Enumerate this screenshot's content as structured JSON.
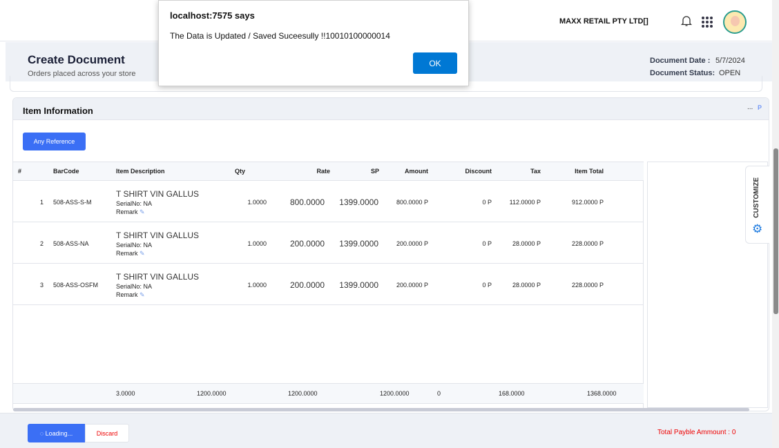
{
  "header": {
    "company": "MAXX RETAIL PTY LTD[]"
  },
  "page": {
    "title": "Create Document",
    "subtitle": "Orders placed across your store",
    "date_label": "Document Date :",
    "date_value": "5/7/2024",
    "status_label": "Document Status:",
    "status_value": "OPEN"
  },
  "items": {
    "title": "Item Information",
    "more": "...",
    "p_link": "P",
    "any_reference": "Any Reference",
    "columns": [
      "#",
      "BarCode",
      "Item Description",
      "Qty",
      "Rate",
      "SP",
      "Amount",
      "Discount",
      "Tax",
      "Item Total"
    ],
    "rows": [
      {
        "no": "1",
        "barcode": "508-ASS-S-M",
        "desc": "T SHIRT VIN GALLUS",
        "serial": "SerialNo: NA",
        "remark": "Remark",
        "qty": "1.0000",
        "rate": "800.0000",
        "sp": "1399.0000",
        "amount": "800.0000 P",
        "discount": "0 P",
        "tax": "112.0000 P",
        "total": "912.0000 P"
      },
      {
        "no": "2",
        "barcode": "508-ASS-NA",
        "desc": "T SHIRT VIN GALLUS",
        "serial": "SerialNo: NA",
        "remark": "Remark",
        "qty": "1.0000",
        "rate": "200.0000",
        "sp": "1399.0000",
        "amount": "200.0000 P",
        "discount": "0 P",
        "tax": "28.0000 P",
        "total": "228.0000 P"
      },
      {
        "no": "3",
        "barcode": "508-ASS-OSFM",
        "desc": "T SHIRT VIN GALLUS",
        "serial": "SerialNo: NA",
        "remark": "Remark",
        "qty": "1.0000",
        "rate": "200.0000",
        "sp": "1399.0000",
        "amount": "200.0000 P",
        "discount": "0 P",
        "tax": "28.0000 P",
        "total": "228.0000 P"
      }
    ],
    "totals": {
      "qty": "3.0000",
      "rate": "1200.0000",
      "sp": "1200.0000",
      "amount": "1200.0000",
      "discount": "0",
      "tax": "168.0000",
      "total": "1368.0000"
    }
  },
  "customize": "CUSTOMIZE",
  "footer": {
    "loading": "Loading...",
    "discard": "Discard",
    "total_payable": "Total Payble Ammount : 0"
  },
  "dialog": {
    "title": "localhost:7575 says",
    "message": "The Data is Updated / Saved Suceesully !!10010100000014",
    "ok": "OK"
  }
}
